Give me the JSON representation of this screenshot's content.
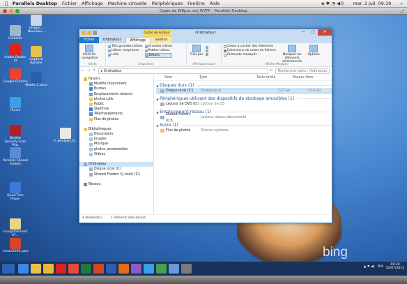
{
  "mac_menubar": {
    "apple": "",
    "items": [
      "Parallels Desktop",
      "Fichier",
      "Affichage",
      "Machine virtuelle",
      "Périphériques",
      "Fenêtre",
      "Aide"
    ],
    "clock": "mar. 2 juil.  09:39"
  },
  "parallels_window": {
    "title": "Copie de W8pro maj W7FP - Parallels Desktop"
  },
  "desktop_icons": [
    {
      "label": "Corbeille",
      "color": "#9fb6cc"
    },
    {
      "label": "Imager... Nouveau...",
      "color": "#c9d8e8"
    },
    {
      "label": "Adobe Reader XI",
      "color": "#d22"
    },
    {
      "label": "Logitech Updater",
      "color": "#e8c24a"
    },
    {
      "label": "Google Chrome",
      "color": "#e6453a"
    },
    {
      "label": "Mobile 1.docx",
      "color": "#2b5fb4"
    },
    {
      "label": "iTunes",
      "color": "#3aa0e8"
    },
    {
      "label": "McAfee Security Scan Plus",
      "color": "#b1202a"
    },
    {
      "label": "fr_windows_8...",
      "color": "#e8e8e8"
    },
    {
      "label": "Parallels Shared Folders",
      "color": "#5a8ad8"
    },
    {
      "label": "QuickTime Player",
      "color": "#3a7ad8"
    },
    {
      "label": "Enregistrement 07...",
      "color": "#e8d48a"
    },
    {
      "label": "essais2000.pptx",
      "color": "#d24726"
    }
  ],
  "explorer": {
    "title": "Ordinateur",
    "context_tab": "Outils de lecteur",
    "tabs": [
      "Fichier",
      "Ordinateur",
      "Affichage",
      "Gestion"
    ],
    "ribbon": {
      "panes": {
        "big": "Volet de navigation",
        "label": "Volets"
      },
      "layout": {
        "items": [
          "Très grandes icônes",
          "Icônes moyennes",
          "Liste",
          "Grandes icônes",
          "Petites icônes",
          "Détails"
        ],
        "selected": "Détails",
        "label": "Disposition"
      },
      "current_view": {
        "big": "Trier par",
        "label": "Affichage actuel"
      },
      "show_hide": {
        "checkboxes": [
          {
            "label": "Cases à cocher des éléments",
            "checked": false
          },
          {
            "label": "Extensions de noms de fichiers",
            "checked": true
          },
          {
            "label": "Éléments masqués",
            "checked": false
          }
        ],
        "hide_selected": "Masquer les éléments sélectionnés",
        "options": "Options",
        "label": "Afficher/Masquer"
      }
    },
    "address": {
      "path": "Ordinateur",
      "search_placeholder": "Rechercher dans : Ordinateur"
    },
    "tree": [
      {
        "label": "Favoris",
        "color": "#e8b83a",
        "indent": 0
      },
      {
        "label": "Modifié récemment",
        "color": "#7aa2d2",
        "indent": 1
      },
      {
        "label": "Bureau",
        "color": "#4a8ad2",
        "indent": 1
      },
      {
        "label": "Emplacements récents",
        "color": "#7aa2d2",
        "indent": 1
      },
      {
        "label": "photos-Lille",
        "color": "#e8c86a",
        "indent": 1
      },
      {
        "label": "Public",
        "color": "#e8c86a",
        "indent": 1
      },
      {
        "label": "SkyDrive",
        "color": "#3a7ad8",
        "indent": 1
      },
      {
        "label": "Téléchargements",
        "color": "#4a8ad2",
        "indent": 1
      },
      {
        "label": "Flux de photos",
        "color": "#e8c86a",
        "indent": 1
      },
      {
        "label": "",
        "color": "",
        "indent": 0
      },
      {
        "label": "Bibliothèques",
        "color": "#e8c86a",
        "indent": 0
      },
      {
        "label": "Documents",
        "color": "#b0c4da",
        "indent": 1
      },
      {
        "label": "Images",
        "color": "#b0c4da",
        "indent": 1
      },
      {
        "label": "Musique",
        "color": "#b0c4da",
        "indent": 1
      },
      {
        "label": "photos personnelles",
        "color": "#b0c4da",
        "indent": 1
      },
      {
        "label": "Vidéos",
        "color": "#b0c4da",
        "indent": 1
      },
      {
        "label": "",
        "color": "",
        "indent": 0
      },
      {
        "label": "Ordinateur",
        "color": "#8aa6c6",
        "indent": 0,
        "selected": true
      },
      {
        "label": "Disque local (C:)",
        "color": "#9ab4cc",
        "indent": 1
      },
      {
        "label": "Shared Folders (\\\\.host) (Z:)",
        "color": "#9ab4cc",
        "indent": 1
      },
      {
        "label": "",
        "color": "",
        "indent": 0
      },
      {
        "label": "Réseau",
        "color": "#6a8ab0",
        "indent": 0
      }
    ],
    "columns": [
      "Nom",
      "Type",
      "Taille totale",
      "Espace libre"
    ],
    "groups": [
      {
        "name": "Disques durs (1)",
        "rows": [
          {
            "name": "Disque local (C:)",
            "type": "Disque local",
            "size": "127 Go",
            "free": "77,0 Go",
            "selected": true,
            "color": "#9ab4cc"
          }
        ]
      },
      {
        "name": "Périphériques utilisant des dispositifs de stockage amovibles (1)",
        "rows": [
          {
            "name": "Lecteur de DVD (D:)",
            "type": "Lecteur de CD",
            "size": "",
            "free": "",
            "color": "#b0b0b0"
          }
        ]
      },
      {
        "name": "Emplacement réseau (1)",
        "rows": [
          {
            "name": "Shared Folders (\\\\.h...",
            "type": "Lecteur réseau déconnecté",
            "size": "",
            "free": "",
            "color": "#9ab4cc"
          }
        ]
      },
      {
        "name": "Autre (1)",
        "rows": [
          {
            "name": "Flux de photos",
            "type": "Dossier système",
            "size": "",
            "free": "",
            "color": "#e8c86a"
          }
        ]
      }
    ],
    "status": {
      "count": "4 élément(s)",
      "selected": "1 élément sélectionné"
    }
  },
  "taskbar": {
    "apps": [
      {
        "name": "ie-icon",
        "color": "#3a8ae8"
      },
      {
        "name": "explorer-icon",
        "color": "#e8c24a"
      },
      {
        "name": "folder-icon",
        "color": "#e8b83a"
      },
      {
        "name": "acrobat-icon",
        "color": "#d22"
      },
      {
        "name": "pdf-icon",
        "color": "#e84a3a"
      },
      {
        "name": "excel-icon",
        "color": "#1d7a3a"
      },
      {
        "name": "powerpoint-icon",
        "color": "#d24726"
      },
      {
        "name": "word-icon",
        "color": "#2b5fb4"
      },
      {
        "name": "firefox-icon",
        "color": "#e86a1a"
      },
      {
        "name": "paint-icon",
        "color": "#8a5ac8"
      },
      {
        "name": "media-icon",
        "color": "#3aa0e8"
      },
      {
        "name": "chrome-icon",
        "color": "#4aa04a"
      },
      {
        "name": "app-icon",
        "color": "#6a9ad8"
      },
      {
        "name": "settings-icon",
        "color": "#7a7a7a"
      }
    ],
    "lang": "FRA",
    "time": "09:39",
    "date": "02/07/2013"
  },
  "bing": "bing"
}
